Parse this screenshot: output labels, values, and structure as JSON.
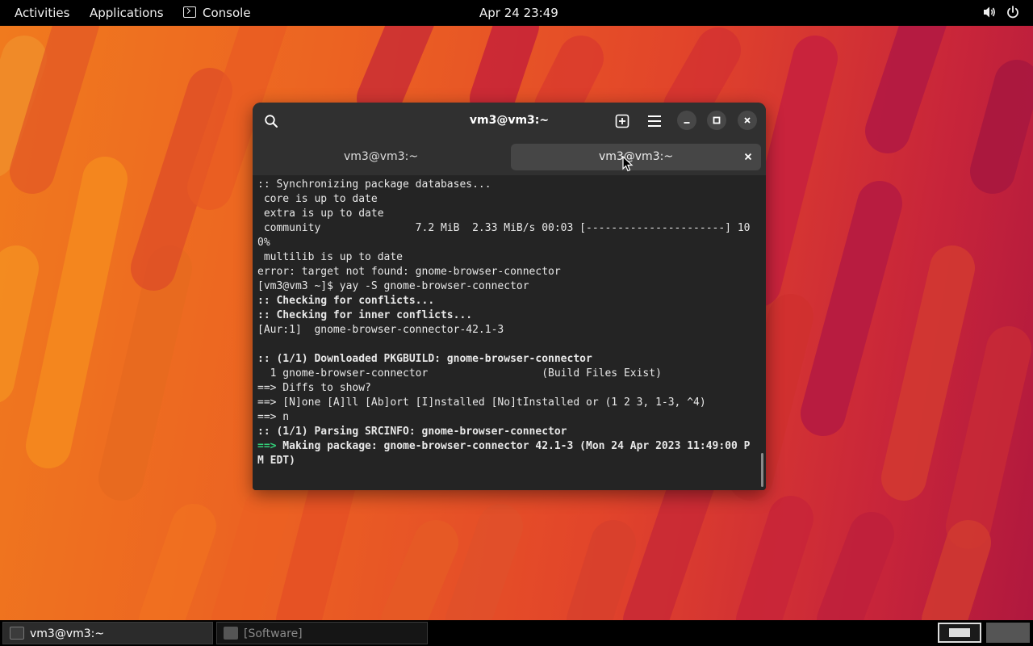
{
  "topbar": {
    "activities": "Activities",
    "applications": "Applications",
    "console": "Console",
    "clock": "Apr 24  23:49",
    "icons": [
      "volume-icon",
      "power-icon"
    ]
  },
  "terminal": {
    "title": "vm3@vm3:~",
    "tabs": [
      {
        "label": "vm3@vm3:~",
        "active": false
      },
      {
        "label": "vm3@vm3:~",
        "active": true
      }
    ],
    "lines": [
      {
        "text": ":: Synchronizing package databases...",
        "style": "normal"
      },
      {
        "text": " core is up to date",
        "style": "normal"
      },
      {
        "text": " extra is up to date",
        "style": "normal"
      },
      {
        "text": " community               7.2 MiB  2.33 MiB/s 00:03 [----------------------] 10",
        "style": "normal"
      },
      {
        "text": "0%",
        "style": "normal"
      },
      {
        "text": " multilib is up to date",
        "style": "normal"
      },
      {
        "text": "error: target not found: gnome-browser-connector",
        "style": "normal"
      },
      {
        "text": "[vm3@vm3 ~]$ yay -S gnome-browser-connector",
        "style": "normal"
      },
      {
        "text": ":: Checking for conflicts...",
        "style": "bold"
      },
      {
        "text": ":: Checking for inner conflicts...",
        "style": "bold"
      },
      {
        "text": "[Aur:1]  gnome-browser-connector-42.1-3",
        "style": "normal"
      },
      {
        "text": "",
        "style": "normal"
      },
      {
        "text": ":: (1/1) Downloaded PKGBUILD: gnome-browser-connector",
        "style": "bold"
      },
      {
        "text": "  1 gnome-browser-connector                  (Build Files Exist)",
        "style": "normal"
      },
      {
        "text": "==> Diffs to show?",
        "style": "normal"
      },
      {
        "text": "==> [N]one [A]ll [Ab]ort [I]nstalled [No]tInstalled or (1 2 3, 1-3, ^4)",
        "style": "normal"
      },
      {
        "text": "==> n",
        "style": "normal"
      },
      {
        "text": ":: (1/1) Parsing SRCINFO: gnome-browser-connector",
        "style": "bold"
      },
      {
        "text": "==> Making package: gnome-browser-connector 42.1-3 (Mon 24 Apr 2023 11:49:00 P",
        "style": "green-prefix"
      },
      {
        "text": "M EDT)",
        "style": "bold"
      }
    ]
  },
  "taskbar": {
    "tasks": [
      {
        "label": "vm3@vm3:~",
        "active": true
      },
      {
        "label": "[Software]",
        "active": false
      }
    ],
    "workspaces": 2
  },
  "colors": {
    "terminal_bg": "#242424",
    "headerbar_bg": "#303030",
    "prompt_arrow_green": "#33d17a",
    "wallpaper_orange": "#ec6322",
    "wallpaper_red": "#c8253a"
  }
}
